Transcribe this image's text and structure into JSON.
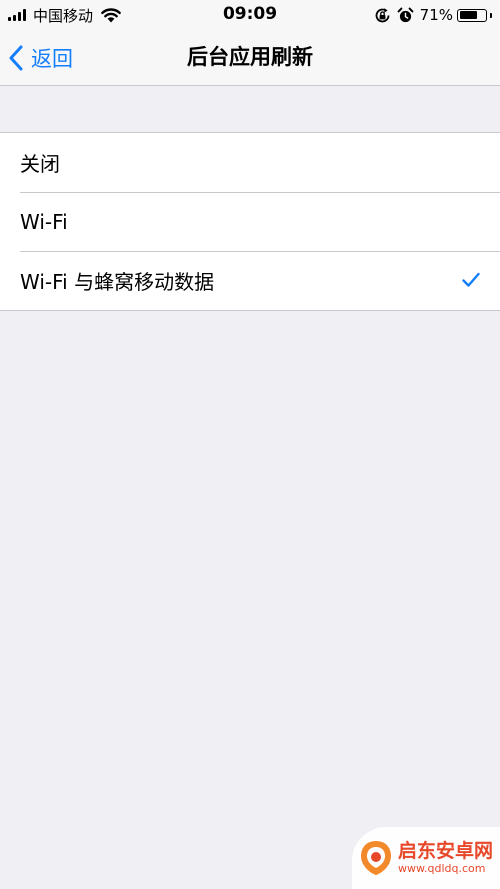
{
  "status_bar": {
    "carrier": "中国移动",
    "time": "09:09",
    "battery_percent": "71%",
    "battery_level": 0.71,
    "icons": [
      "signal-icon",
      "wifi-icon",
      "rotation-lock-icon",
      "alarm-icon",
      "battery-icon"
    ]
  },
  "nav": {
    "back_label": "返回",
    "title": "后台应用刷新"
  },
  "options": {
    "items": [
      {
        "label": "关闭",
        "selected": false
      },
      {
        "label": "Wi-Fi",
        "selected": false
      },
      {
        "label": "Wi-Fi 与蜂窝移动数据",
        "selected": true
      }
    ]
  },
  "colors": {
    "accent": "#157efb",
    "background": "#efeff4",
    "cell": "#ffffff",
    "separator": "#c8c7cc",
    "watermark": "#e8482a"
  },
  "watermark": {
    "name": "启东安卓网",
    "url": "www.qdldq.com"
  }
}
